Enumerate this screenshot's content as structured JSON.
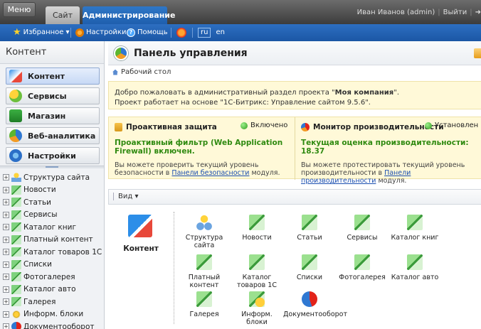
{
  "topbar": {
    "menu_label": "Меню",
    "tab_site": "Сайт",
    "tab_admin": "Администрирование",
    "user_name": "Иван Иванов (admin)",
    "logout_label": "Выйти"
  },
  "toolbar": {
    "favorites": "Избранное",
    "settings": "Настройки",
    "help": "Помощь",
    "lang_ru": "ru",
    "lang_en": "en"
  },
  "sidebar": {
    "title": "Контент",
    "buttons": [
      {
        "label": "Контент"
      },
      {
        "label": "Сервисы"
      },
      {
        "label": "Магазин"
      },
      {
        "label": "Веб-аналитика"
      },
      {
        "label": "Настройки"
      }
    ],
    "tree": [
      {
        "label": "Структура сайта",
        "icon": "site-structure-icon"
      },
      {
        "label": "Новости",
        "icon": "iblock-icon"
      },
      {
        "label": "Статьи",
        "icon": "iblock-icon"
      },
      {
        "label": "Сервисы",
        "icon": "iblock-icon"
      },
      {
        "label": "Каталог книг",
        "icon": "iblock-icon"
      },
      {
        "label": "Платный контент",
        "icon": "iblock-icon"
      },
      {
        "label": "Каталог товаров 1С",
        "icon": "iblock-icon"
      },
      {
        "label": "Списки",
        "icon": "iblock-icon"
      },
      {
        "label": "Фотогалерея",
        "icon": "iblock-icon"
      },
      {
        "label": "Каталог авто",
        "icon": "iblock-icon"
      },
      {
        "label": "Галерея",
        "icon": "iblock-icon"
      },
      {
        "label": "Информ. блоки",
        "icon": "iblock-gear-icon"
      },
      {
        "label": "Документооборот",
        "icon": "workflow-icon"
      }
    ]
  },
  "main": {
    "title": "Панель управления",
    "breadcrumb": "Рабочий стол",
    "welcome_line1_prefix": "Добро пожаловать в административный раздел проекта \"",
    "welcome_project": "Моя компания",
    "welcome_line1_suffix": "\".",
    "welcome_line2": "Проект работает на основе \"1С-Битрикс: Управление сайтом 9.5.6\".",
    "security": {
      "title": "Проактивная защита",
      "status": "Включено",
      "highlight": "Проактивный фильтр (Web Application Firewall) включен.",
      "text_prefix": "Вы можете проверить текущий уровень безопасности в ",
      "link": "Панели безопасности",
      "text_suffix": " модуля."
    },
    "performance": {
      "title": "Монитор производительности",
      "status": "Установлен",
      "highlight": "Текущая оценка производительности: 18.37",
      "text_prefix": "Вы можете протестировать текущий уровень производительности в ",
      "link": "Панели производительности",
      "text_suffix": " модуля."
    },
    "view_label": "Вид ▾",
    "category_label": "Контент",
    "grid": [
      {
        "label": "Структура сайта",
        "icon": "site-structure-icon"
      },
      {
        "label": "Новости",
        "icon": "iblock-icon"
      },
      {
        "label": "Статьи",
        "icon": "iblock-icon"
      },
      {
        "label": "Сервисы",
        "icon": "iblock-icon"
      },
      {
        "label": "Каталог книг",
        "icon": "iblock-icon"
      },
      {
        "label": "Платный контент",
        "icon": "iblock-icon"
      },
      {
        "label": "Каталог товаров 1С",
        "icon": "iblock-icon"
      },
      {
        "label": "Списки",
        "icon": "iblock-icon"
      },
      {
        "label": "Фотогалерея",
        "icon": "iblock-icon"
      },
      {
        "label": "Каталог авто",
        "icon": "iblock-icon"
      },
      {
        "label": "Галерея",
        "icon": "iblock-icon"
      },
      {
        "label": "Информ. блоки",
        "icon": "iblock-gear-icon"
      },
      {
        "label": "Документооборот",
        "icon": "workflow-icon"
      }
    ]
  }
}
